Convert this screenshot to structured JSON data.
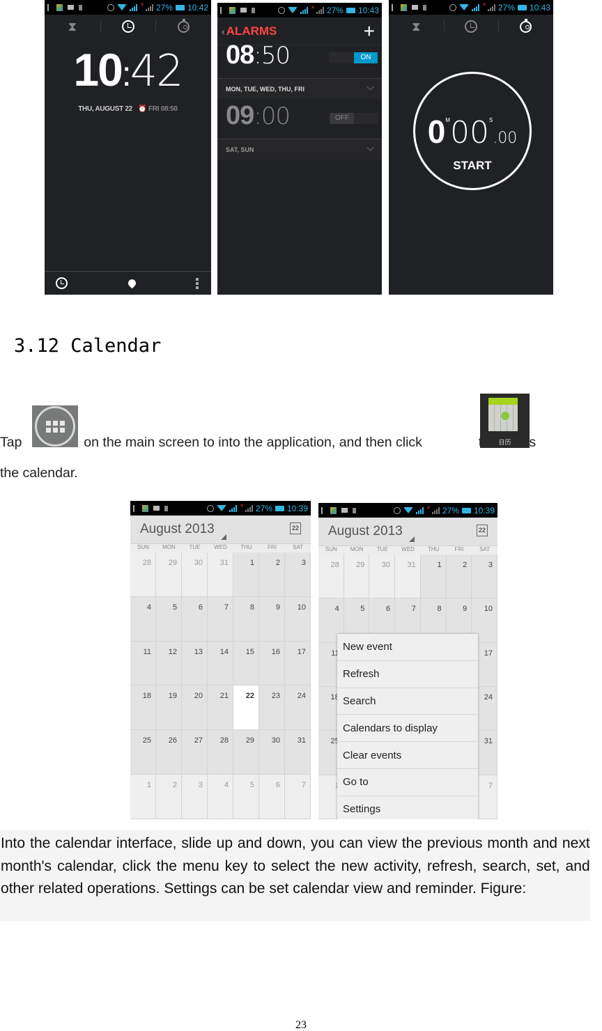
{
  "screens_top": {
    "clock": {
      "status_time": "10:42",
      "battery": "27%",
      "tabs": [
        "timer-icon",
        "clock-icon",
        "stopwatch-icon"
      ],
      "active_tab": 1,
      "hours": "10",
      "minutes": "42",
      "date": "THU, AUGUST 22",
      "next_alarm": "FRI 08:50",
      "bottom_actions": [
        "alarm-icon",
        "location-pin-icon",
        "overflow-menu-icon"
      ]
    },
    "alarms": {
      "status_time": "10:43",
      "battery": "27%",
      "title": "ALARMS",
      "add_label": "+",
      "items": [
        {
          "hours": "08",
          "minutes": "50",
          "state": "ON",
          "days": "MON, TUE, WED, THU, FRI"
        },
        {
          "hours": "09",
          "minutes": "00",
          "state": "OFF",
          "days": "SAT, SUN"
        }
      ]
    },
    "stopwatch": {
      "status_time": "10:43",
      "battery": "27%",
      "minutes": "0",
      "minutes_unit": "M",
      "seconds": "00",
      "seconds_unit": "S",
      "centiseconds": ".00",
      "start_label": "START"
    }
  },
  "section": {
    "heading": "3.12 Calendar",
    "para1_part1": "Tap",
    "para1_part2": "on the main screen to into the application, and then click",
    "para1_part3": "to access",
    "para1_line2": "the calendar.",
    "calendar_icon_label": "日历",
    "para2": "Into the calendar interface, slide up and down, you can view the previous month and next month's calendar, click the menu key to select the new activity, refresh, search, set, and other related operations. Settings can be set calendar view and reminder. Figure:"
  },
  "calendar": {
    "status_time": "10:39",
    "battery": "27%",
    "month_title": "August 2013",
    "today_icon_label": "22",
    "days_of_week": [
      "SUN",
      "MON",
      "TUE",
      "WED",
      "THU",
      "FRI",
      "SAT"
    ],
    "weeks": [
      [
        {
          "d": "28",
          "o": true
        },
        {
          "d": "29",
          "o": true
        },
        {
          "d": "30",
          "o": true
        },
        {
          "d": "31",
          "o": true
        },
        {
          "d": "1"
        },
        {
          "d": "2"
        },
        {
          "d": "3"
        }
      ],
      [
        {
          "d": "4"
        },
        {
          "d": "5"
        },
        {
          "d": "6"
        },
        {
          "d": "7"
        },
        {
          "d": "8"
        },
        {
          "d": "9"
        },
        {
          "d": "10"
        }
      ],
      [
        {
          "d": "11"
        },
        {
          "d": "12"
        },
        {
          "d": "13"
        },
        {
          "d": "14"
        },
        {
          "d": "15"
        },
        {
          "d": "16"
        },
        {
          "d": "17"
        }
      ],
      [
        {
          "d": "18"
        },
        {
          "d": "19"
        },
        {
          "d": "20"
        },
        {
          "d": "21"
        },
        {
          "d": "22",
          "t": true
        },
        {
          "d": "23"
        },
        {
          "d": "24"
        }
      ],
      [
        {
          "d": "25"
        },
        {
          "d": "26"
        },
        {
          "d": "27"
        },
        {
          "d": "28"
        },
        {
          "d": "29"
        },
        {
          "d": "30"
        },
        {
          "d": "31"
        }
      ],
      [
        {
          "d": "1",
          "o": true
        },
        {
          "d": "2",
          "o": true
        },
        {
          "d": "3",
          "o": true
        },
        {
          "d": "4",
          "o": true
        },
        {
          "d": "5",
          "o": true
        },
        {
          "d": "6",
          "o": true
        },
        {
          "d": "7",
          "o": true
        }
      ]
    ],
    "menu_items": [
      "New event",
      "Refresh",
      "Search",
      "Calendars to display",
      "Clear events",
      "Go to",
      "Settings"
    ]
  },
  "page_number": "23",
  "colors": {
    "holo_blue": "#33b5e5",
    "alarm_red": "#ff4444",
    "toggle_on": "#0099cc",
    "dark_bg": "#202124"
  }
}
